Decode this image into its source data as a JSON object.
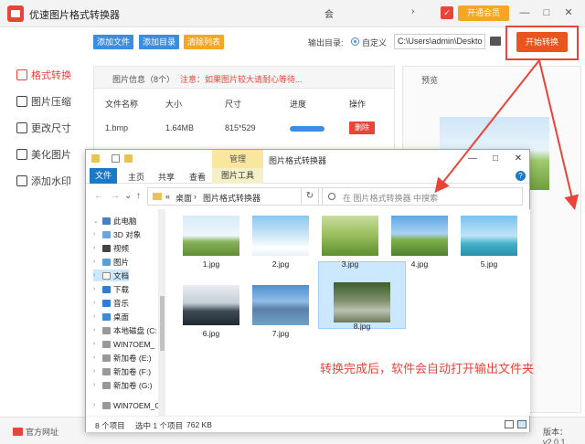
{
  "app": {
    "title": "优速图片格式转换器",
    "titlebar_mid": "会",
    "titlebar_mid2": "›",
    "vip_label": "开通会员",
    "sidebar": [
      {
        "label": "格式转换",
        "active": true
      },
      {
        "label": "图片压缩",
        "active": false
      },
      {
        "label": "更改尺寸",
        "active": false
      },
      {
        "label": "美化图片",
        "active": false
      },
      {
        "label": "添加水印",
        "active": false
      }
    ],
    "toolbar": {
      "add_file": "添加文件",
      "add_dir": "添加目录",
      "clear_list": "清除列表",
      "output_dir_label": "输出目录:",
      "custom_label": "自定义",
      "output_path": "C:\\Users\\admin\\Deskto",
      "start_label": "开始转换"
    },
    "info": {
      "title": "图片信息（8个）",
      "note": "注意：如果图片较大请耐心等待...",
      "columns": [
        "文件名称",
        "大小",
        "尺寸",
        "进度",
        "操作"
      ],
      "row": {
        "name": "1.bmp",
        "size": "1.64MB",
        "dims": "815*529",
        "progress": 1.0,
        "delete_label": "删除"
      }
    },
    "preview_title": "预览",
    "bottom": {
      "website": "官方网址",
      "version": "版本：v2.0.1"
    },
    "colors": {
      "accent": "#e8443a",
      "blue": "#3a8de0",
      "orange": "#f5a623"
    }
  },
  "explorer": {
    "manage_tab": "管理",
    "title": "图片格式转换器",
    "ribbon": {
      "file": "文件",
      "home": "主页",
      "share": "共享",
      "view": "查看",
      "picture_tools": "图片工具"
    },
    "address": {
      "prefix": "«",
      "seg1": "桌面",
      "sep": "›",
      "seg2": "图片格式转换器"
    },
    "search_placeholder": "在 图片格式转换器 中搜索",
    "tree": [
      {
        "label": "此电脑",
        "icon": "computer-icon"
      },
      {
        "label": "3D 对象",
        "icon": "cube-icon"
      },
      {
        "label": "视频",
        "icon": "video-icon"
      },
      {
        "label": "图片",
        "icon": "picture-icon"
      },
      {
        "label": "文档",
        "icon": "document-icon"
      },
      {
        "label": "下载",
        "icon": "download-icon"
      },
      {
        "label": "音乐",
        "icon": "music-icon"
      },
      {
        "label": "桌面",
        "icon": "desktop-icon"
      },
      {
        "label": "本地磁盘 (C:",
        "icon": "drive-icon"
      },
      {
        "label": "WIN7OEM_",
        "icon": "drive-icon"
      },
      {
        "label": "新加卷 (E:)",
        "icon": "drive-icon"
      },
      {
        "label": "新加卷 (F:)",
        "icon": "drive-icon"
      },
      {
        "label": "新加卷 (G:)",
        "icon": "drive-icon"
      },
      {
        "label": "WIN7OEM_C",
        "icon": "drive-icon"
      }
    ],
    "files": [
      {
        "name": "1.jpg"
      },
      {
        "name": "2.jpg"
      },
      {
        "name": "3.jpg"
      },
      {
        "name": "4.jpg"
      },
      {
        "name": "5.jpg"
      },
      {
        "name": "6.jpg"
      },
      {
        "name": "7.jpg"
      },
      {
        "name": "8.jpg"
      }
    ],
    "annotation": "转换完成后，软件会自动打开输出文件夹",
    "status": {
      "count": "8 个项目",
      "selected": "选中 1 个项目",
      "size": "762 KB"
    }
  }
}
